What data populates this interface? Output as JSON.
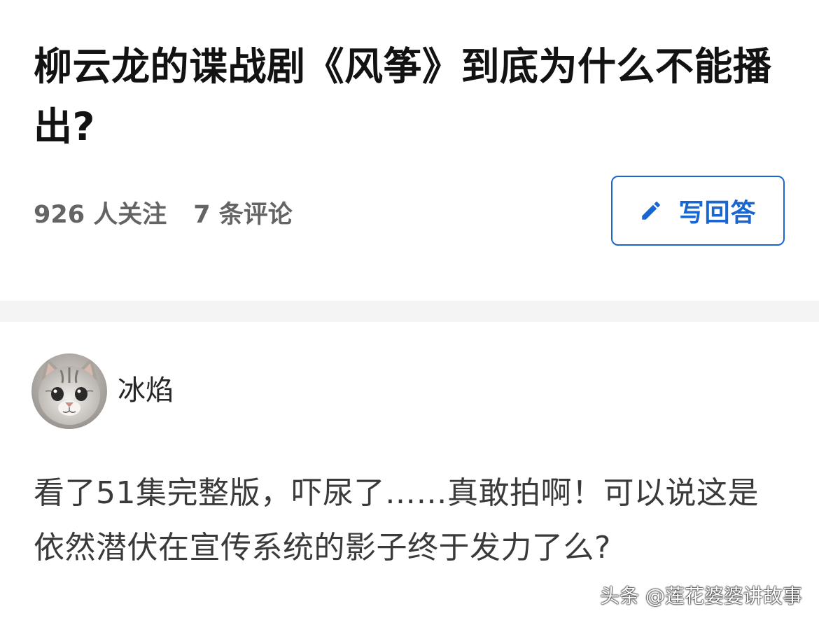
{
  "question": {
    "title": "柳云龙的谍战剧《风筝》到底为什么不能播出?",
    "followers": "926 人关注",
    "comments": "7 条评论",
    "write_answer_label": "写回答"
  },
  "answer": {
    "author_name": "冰焰",
    "text": "看了51集完整版，吓尿了……真敢拍啊！可以说这是依然潜伏在宣传系统的影子终于发力了么?"
  },
  "watermark": "头条 @莲花婆婆讲故事",
  "icons": {
    "write": "pencil-icon",
    "avatar": "cat-avatar"
  },
  "colors": {
    "accent": "#1a66d1",
    "title": "#121212",
    "meta": "#646464",
    "body_text": "#3a3a3a",
    "divider": "#f4f4f5"
  }
}
